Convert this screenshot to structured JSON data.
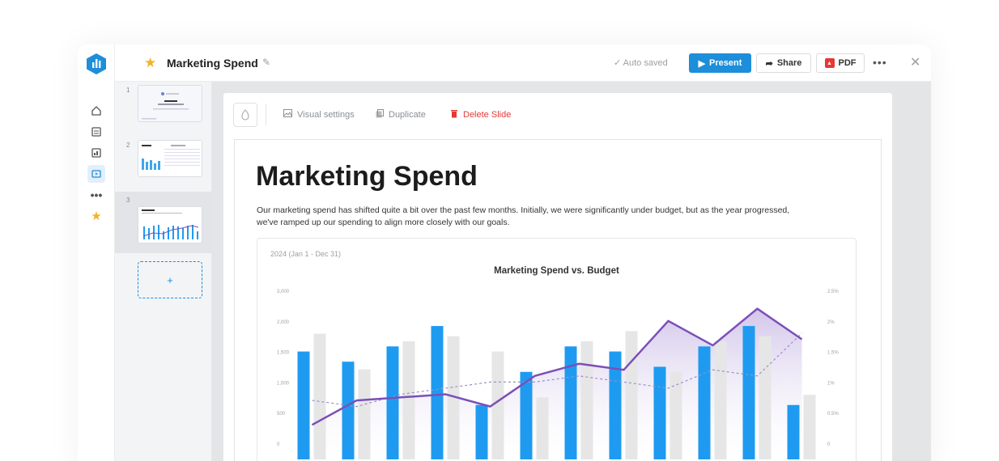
{
  "app": {
    "title": "Marketing Spend",
    "autosave": "Auto saved",
    "buttons": {
      "present": "Present",
      "share": "Share",
      "pdf": "PDF"
    },
    "brand_color": "#1d8ed9"
  },
  "rail": {
    "icons": [
      "home-icon",
      "dashboard-icon",
      "report-icon",
      "presentation-icon",
      "more-icon",
      "favorites-star-icon"
    ]
  },
  "slides": [
    {
      "number": "1"
    },
    {
      "number": "2"
    },
    {
      "number": "3"
    }
  ],
  "add_slide": "+",
  "toolbar": {
    "visual_settings": "Visual settings",
    "duplicate": "Duplicate",
    "delete": "Delete Slide"
  },
  "slide": {
    "title": "Marketing Spend",
    "description": "Our marketing spend has shifted quite a bit over the past few months. Initially, we were significantly under budget, but as the year progressed, we've ramped up our spending to align more closely with our goals."
  },
  "chart_data": {
    "type": "bar",
    "date_range": "2024 (Jan 1 - Dec 31)",
    "title": "Marketing Spend vs. Budget",
    "left_axis": {
      "ticks": [
        "3,000",
        "2,000",
        "1,500",
        "1,000",
        "500",
        "0"
      ]
    },
    "right_axis": {
      "ticks": [
        "2.5%",
        "2%",
        "1.5%",
        "1%",
        "0.5%",
        "0"
      ]
    },
    "categories": 12,
    "series": [
      {
        "values": [
          1800,
          1600,
          1900,
          2300,
          750,
          1400,
          1900,
          1800,
          1500,
          1900,
          2300,
          750
        ],
        "color": "#1e9bf0"
      },
      {
        "values": [
          2150,
          1450,
          2000,
          2100,
          1800,
          900,
          2000,
          2200,
          1400,
          2000,
          2100,
          950
        ],
        "color": "#e6e6e6"
      }
    ],
    "line_values": [
      0.3,
      0.7,
      0.75,
      0.8,
      0.6,
      1.1,
      1.3,
      1.2,
      2.0,
      1.6,
      2.2,
      1.7
    ],
    "line_color": "#7b4fb8",
    "dashed_values": [
      0.7,
      0.6,
      0.8,
      0.9,
      1.0,
      1.0,
      1.1,
      1.0,
      0.9,
      1.2,
      1.1,
      1.8
    ],
    "ylim": [
      0,
      3000
    ]
  }
}
